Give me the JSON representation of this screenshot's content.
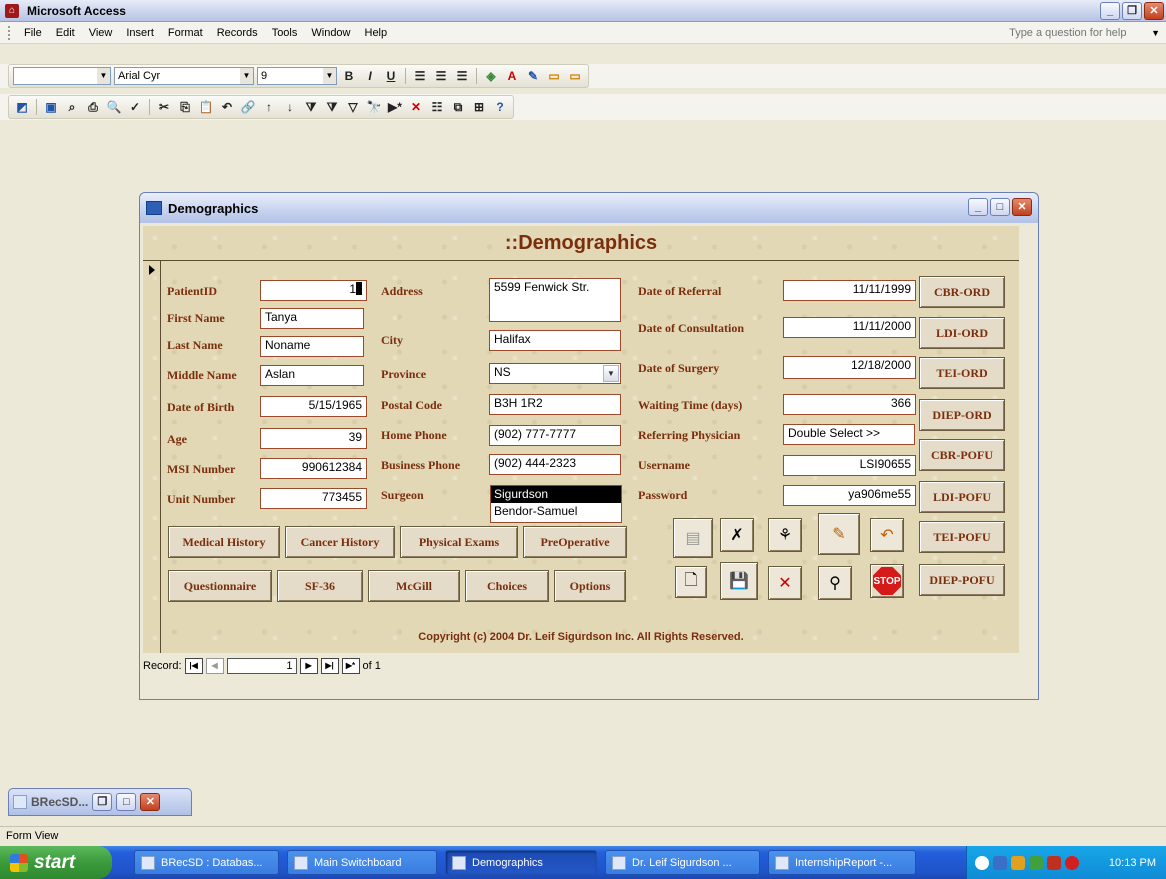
{
  "app": {
    "title": "Microsoft Access"
  },
  "menu": [
    "File",
    "Edit",
    "View",
    "Insert",
    "Format",
    "Records",
    "Tools",
    "Window",
    "Help"
  ],
  "help": {
    "placeholder": "Type a question for help"
  },
  "format_toolbar": {
    "font": "Arial Cyr",
    "size": "9",
    "bold": "B",
    "italic": "I",
    "underline": "U"
  },
  "form": {
    "window_title": "Demographics",
    "header": "::Demographics",
    "labels": {
      "patient_id": "PatientID",
      "first_name": "First Name",
      "last_name": "Last Name",
      "middle_name": "Middle Name",
      "dob": "Date of Birth",
      "age": "Age",
      "msi": "MSI Number",
      "unit": "Unit Number",
      "address": "Address",
      "city": "City",
      "province": "Province",
      "postal": "Postal Code",
      "home_phone": "Home Phone",
      "business_phone": "Business Phone",
      "surgeon": "Surgeon",
      "referral": "Date of Referral",
      "consultation": "Date of Consultation",
      "surgery": "Date of Surgery",
      "waiting": "Waiting Time (days)",
      "physician": "Referring Physician",
      "username": "Username",
      "password": "Password"
    },
    "values": {
      "patient_id": "1",
      "first_name": "Tanya",
      "last_name": "Noname",
      "middle_name": "Aslan",
      "dob": "5/15/1965",
      "age": "39",
      "msi": "990612384",
      "unit": "773455",
      "address": "5599 Fenwick Str.",
      "city": "Halifax",
      "province": "NS",
      "postal": "B3H 1R2",
      "home_phone": "(902) 777-7777",
      "business_phone": "(902) 444-2323",
      "referral": "11/11/1999",
      "consultation": "11/11/2000",
      "surgery": "12/18/2000",
      "waiting": "366",
      "physician": "Double Select >>",
      "username": "LSI90655",
      "password": "ya906me55"
    },
    "surgeons": [
      "Sigurdson",
      "Bendor-Samuel"
    ],
    "side_buttons": [
      "CBR-ORD",
      "LDI-ORD",
      "TEI-ORD",
      "DIEP-ORD",
      "CBR-POFU",
      "LDI-POFU",
      "TEI-POFU",
      "DIEP-POFU"
    ],
    "row1_buttons": [
      "Medical History",
      "Cancer History",
      "Physical Exams",
      "PreOperative"
    ],
    "row2_buttons": [
      "Questionnaire",
      "SF-36",
      "McGill",
      "Choices",
      "Options"
    ],
    "icon_buttons": [
      "report-icon",
      "undo-field-icon",
      "find-icon",
      "edit-icon",
      "undo-icon",
      "print-preview-icon",
      "save-icon",
      "delete-icon",
      "binoculars-icon",
      "stop-icon"
    ],
    "stop_label": "STOP",
    "copyright": "Copyright (c) 2004 Dr. Leif Sigurdson Inc. All Rights Reserved.",
    "nav": {
      "label": "Record:",
      "current": "1",
      "of": "of 1"
    }
  },
  "minimized": {
    "title": "BRecSD..."
  },
  "status": "Form View",
  "taskbar": {
    "start": "start",
    "tasks": [
      "BRecSD : Databas...",
      "Main Switchboard",
      "Demographics",
      "Dr. Leif Sigurdson ...",
      "InternshipReport -..."
    ],
    "clock": "10:13 PM"
  }
}
